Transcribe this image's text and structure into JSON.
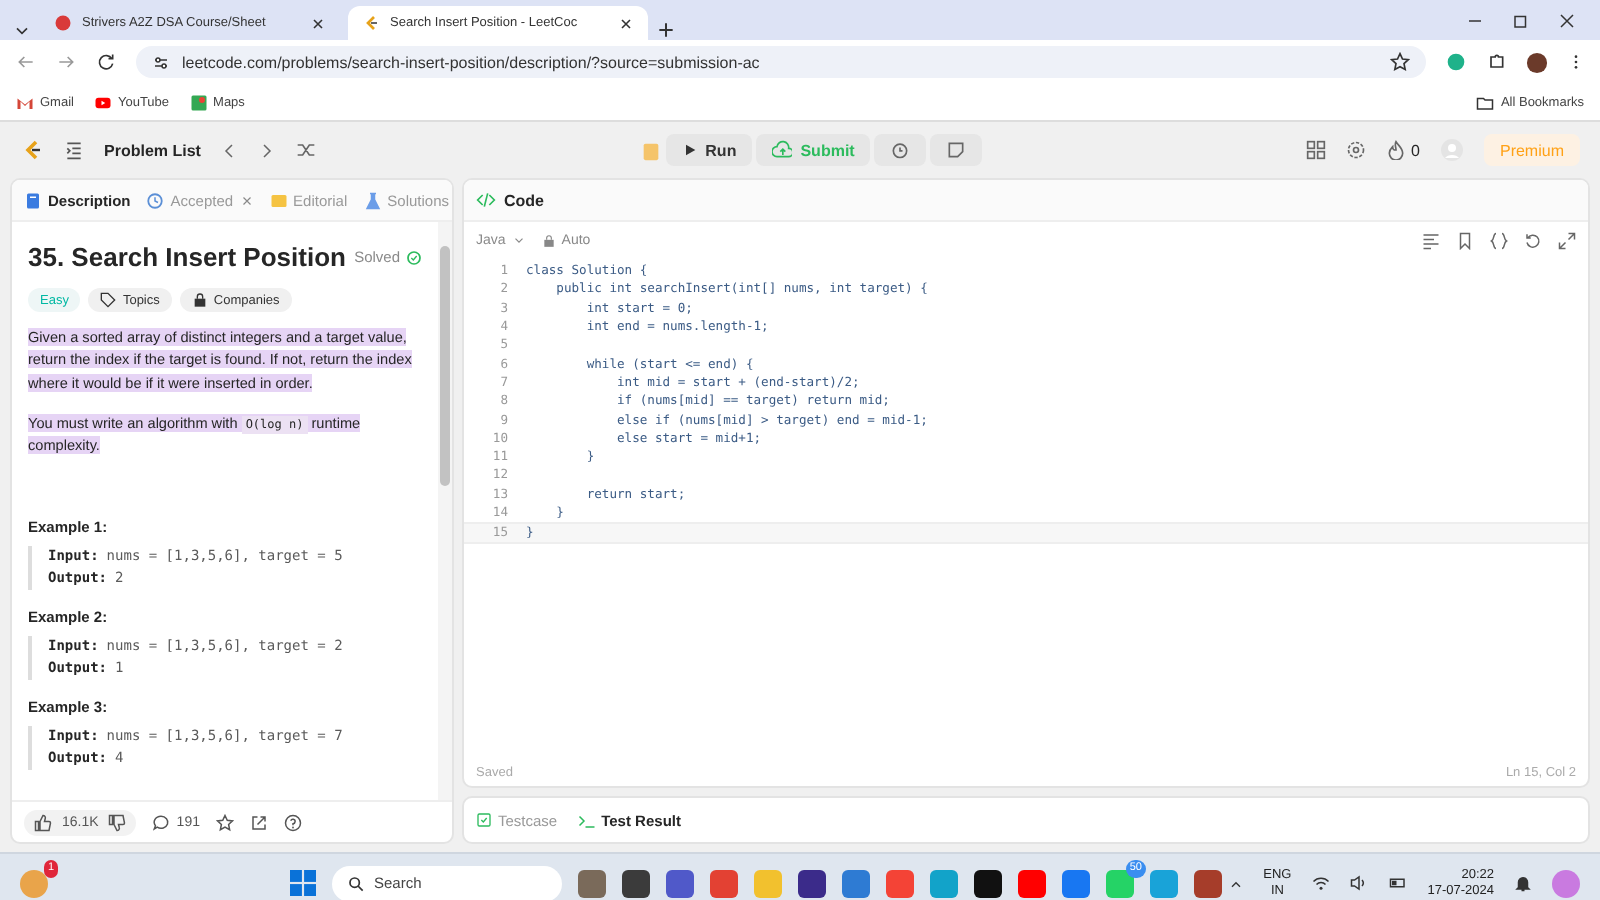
{
  "browser": {
    "tabs": [
      {
        "title": "Strivers A2Z DSA Course/Sheet",
        "selected": false
      },
      {
        "title": "Search Insert Position - LeetCoc",
        "selected": true
      }
    ],
    "url": "leetcode.com/problems/search-insert-position/description/?source=submission-ac",
    "bookmarks": [
      "Gmail",
      "YouTube",
      "Maps"
    ],
    "all_bookmarks": "All Bookmarks"
  },
  "nav": {
    "problem_list": "Problem List",
    "run": "Run",
    "submit": "Submit",
    "streak": "0",
    "premium": "Premium"
  },
  "left": {
    "tabs": [
      {
        "label": "Description",
        "selected": true
      },
      {
        "label": "Accepted",
        "selected": false
      },
      {
        "label": "Editorial",
        "selected": false
      },
      {
        "label": "Solutions",
        "selected": false
      }
    ],
    "title": "35. Search Insert Position",
    "status": "Solved",
    "tags": [
      {
        "kind": "difficulty",
        "label": "Easy"
      },
      {
        "kind": "topics",
        "label": "Topics"
      },
      {
        "kind": "companies",
        "label": "Companies"
      }
    ],
    "paragraphs": [
      {
        "highlighted": true,
        "parts": [
          {
            "kind": "text",
            "text": "Given a sorted array of distinct integers and a target value, return the index if the target is found. If not, return the index where it would be if it were inserted in order."
          }
        ]
      },
      {
        "highlighted": true,
        "parts": [
          {
            "kind": "text",
            "text": "You must write an algorithm with "
          },
          {
            "kind": "code",
            "text": "O(log n)"
          },
          {
            "kind": "text",
            "text": " runtime complexity."
          }
        ]
      }
    ],
    "examples": [
      {
        "title": "Example 1:",
        "input_label": "Input:",
        "input": "nums = [1,3,5,6], target = 5",
        "output_label": "Output:",
        "output": "2"
      },
      {
        "title": "Example 2:",
        "input_label": "Input:",
        "input": "nums = [1,3,5,6], target = 2",
        "output_label": "Output:",
        "output": "1"
      },
      {
        "title": "Example 3:",
        "input_label": "Input:",
        "input": "nums = [1,3,5,6], target = 7",
        "output_label": "Output:",
        "output": "4"
      }
    ],
    "likes": "16.1K",
    "comments": "191"
  },
  "editor": {
    "title": "Code",
    "language": "Java",
    "mode": "Auto",
    "lines": [
      {
        "number": "1",
        "code": "class Solution {"
      },
      {
        "number": "2",
        "code": "    public int searchInsert(int[] nums, int target) {"
      },
      {
        "number": "3",
        "code": "        int start = 0;"
      },
      {
        "number": "4",
        "code": "        int end = nums.length-1;"
      },
      {
        "number": "5"
      },
      {
        "number": "6",
        "code": "        while (start <= end) {"
      },
      {
        "number": "7",
        "code": "            int mid = start + (end-start)/2;"
      },
      {
        "number": "8",
        "code": "            if (nums[mid] == target) return mid;"
      },
      {
        "number": "9",
        "code": "            else if (nums[mid] > target) end = mid-1;"
      },
      {
        "number": "10",
        "code": "            else start = mid+1;"
      },
      {
        "number": "11",
        "code": "        }"
      },
      {
        "number": "12"
      },
      {
        "number": "13",
        "code": "        return start;"
      },
      {
        "number": "14",
        "code": "    }"
      },
      {
        "number": "15",
        "code": "}"
      }
    ],
    "save_status": "Saved",
    "cursor": "Ln 15, Col 2",
    "bottom_tabs": [
      {
        "label": "Testcase",
        "selected": false
      },
      {
        "label": "Test Result",
        "selected": true
      }
    ]
  },
  "taskbar": {
    "notification_count": "1",
    "search": "Search",
    "whatsapp_count": "50",
    "language": "ENG",
    "region": "IN",
    "time": "20:22",
    "date": "17-07-2024"
  }
}
